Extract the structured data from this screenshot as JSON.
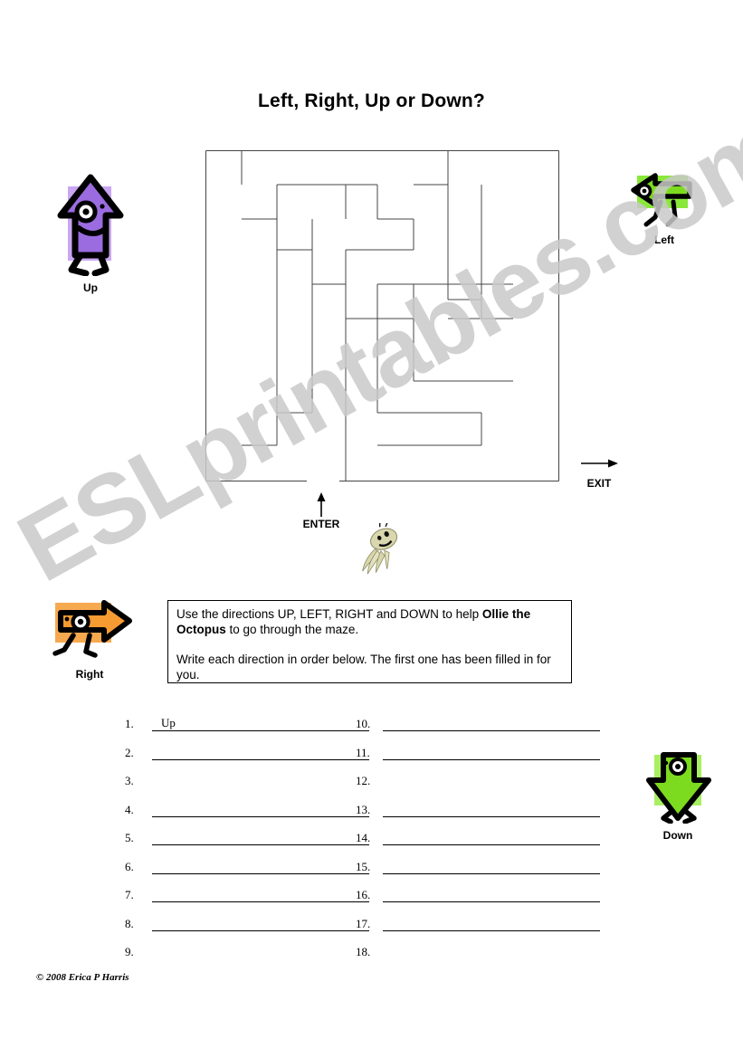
{
  "page": {
    "title": "Left, Right, Up or Down?",
    "watermark": "ESLprintables.com",
    "copyright": "© 2008 Erica P Harris"
  },
  "maze": {
    "enter_label": "ENTER",
    "exit_label": "EXIT",
    "enter_arrow_icon": "arrow-up-icon",
    "exit_arrow_icon": "arrow-right-icon",
    "mascot_icon": "octopus-icon"
  },
  "direction_icons": [
    {
      "key": "up",
      "label": "Up",
      "icon": "arrow-up-character-icon",
      "color": "#9b6ce0",
      "bg_color": "#c9a6f2"
    },
    {
      "key": "left",
      "label": "Left",
      "icon": "arrow-left-character-icon",
      "color": "#7ddb1f",
      "bg_color": "#8ae83a"
    },
    {
      "key": "right",
      "label": "Right",
      "icon": "arrow-right-character-icon",
      "color": "#f59b32",
      "bg_color": "#f7a94f"
    },
    {
      "key": "down",
      "label": "Down",
      "icon": "arrow-down-character-icon",
      "color": "#7ddb1f",
      "bg_color": "#a8ef62"
    }
  ],
  "instructions": {
    "line1_a": "Use the directions UP, LEFT, RIGHT and DOWN to help ",
    "line1_bold": "Ollie the Octopus",
    "line1_b": " to go through the maze.",
    "line2": "Write each direction in order below. The first one has been filled in for you."
  },
  "answers": {
    "left_column": [
      {
        "num": "1.",
        "value": "Up",
        "has_line": true
      },
      {
        "num": "2.",
        "value": "",
        "has_line": true
      },
      {
        "num": "3.",
        "value": "",
        "has_line": false
      },
      {
        "num": "4.",
        "value": "",
        "has_line": true
      },
      {
        "num": "5.",
        "value": "",
        "has_line": true
      },
      {
        "num": "6.",
        "value": "",
        "has_line": true
      },
      {
        "num": "7.",
        "value": "",
        "has_line": true
      },
      {
        "num": "8.",
        "value": "",
        "has_line": true
      },
      {
        "num": "9.",
        "value": "",
        "has_line": false
      }
    ],
    "right_column": [
      {
        "num": "10.",
        "value": "",
        "has_line": true
      },
      {
        "num": "11.",
        "value": "",
        "has_line": true
      },
      {
        "num": "12.",
        "value": "",
        "has_line": false
      },
      {
        "num": "13.",
        "value": "",
        "has_line": true
      },
      {
        "num": "14.",
        "value": "",
        "has_line": true
      },
      {
        "num": "15.",
        "value": "",
        "has_line": true
      },
      {
        "num": "16.",
        "value": "",
        "has_line": true
      },
      {
        "num": "17.",
        "value": "",
        "has_line": true
      },
      {
        "num": "18.",
        "value": "",
        "has_line": false
      }
    ]
  }
}
